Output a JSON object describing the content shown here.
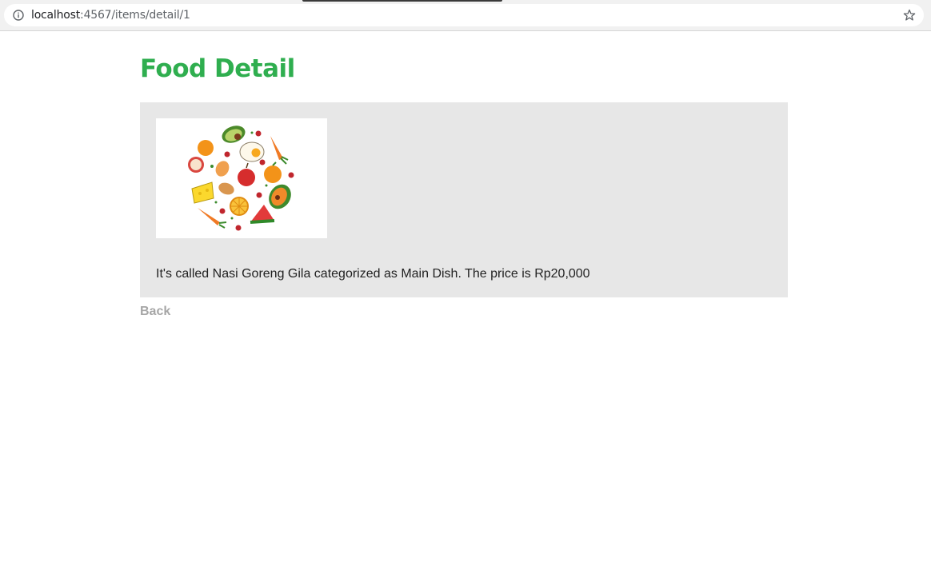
{
  "browser": {
    "url_host": "localhost",
    "url_path": ":4567/items/detail/1",
    "info_icon": "info-icon",
    "bookmark_icon": "star-icon"
  },
  "page": {
    "title": "Food Detail",
    "title_color": "#2fae4f",
    "card_background": "#e7e7e7"
  },
  "item": {
    "image": "food-illustration",
    "description": "It's called Nasi Goreng Gila categorized as Main Dish. The price is Rp20,000"
  },
  "nav": {
    "back_label": "Back"
  }
}
